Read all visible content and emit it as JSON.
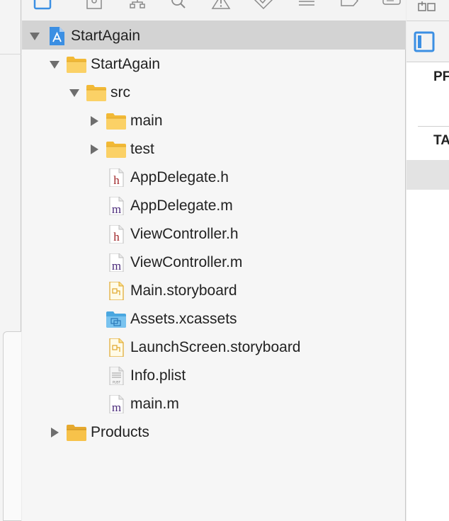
{
  "colors": {
    "accent_blue": "#3b8fe3",
    "folder_yellow": "#f7c24a",
    "header_red": "#a0272a",
    "impl_purple": "#4a2a7a",
    "selection_gray": "#d3d3d3"
  },
  "navigator": {
    "toolbar_icons": [
      "project-navigator-icon",
      "symbol-navigator-icon",
      "hierarchy-icon",
      "find-icon",
      "issue-warning-icon",
      "test-diamond-icon",
      "debug-list-icon",
      "breakpoint-tag-icon",
      "report-bubble-icon"
    ],
    "tree": [
      {
        "label": "StartAgain",
        "level": 0,
        "disclosure": "expanded",
        "icon": "project-icon",
        "selected": true
      },
      {
        "label": "StartAgain",
        "level": 1,
        "disclosure": "expanded",
        "icon": "folder-icon",
        "selected": false
      },
      {
        "label": "src",
        "level": 2,
        "disclosure": "expanded",
        "icon": "folder-icon",
        "selected": false
      },
      {
        "label": "main",
        "level": 3,
        "disclosure": "collapsed",
        "icon": "folder-icon",
        "selected": false
      },
      {
        "label": "test",
        "level": 3,
        "disclosure": "collapsed",
        "icon": "folder-icon",
        "selected": false
      },
      {
        "label": "AppDelegate.h",
        "level": 3,
        "disclosure": "none",
        "icon": "header-file-icon",
        "selected": false
      },
      {
        "label": "AppDelegate.m",
        "level": 3,
        "disclosure": "none",
        "icon": "implementation-file-icon",
        "selected": false
      },
      {
        "label": "ViewController.h",
        "level": 3,
        "disclosure": "none",
        "icon": "header-file-icon",
        "selected": false
      },
      {
        "label": "ViewController.m",
        "level": 3,
        "disclosure": "none",
        "icon": "implementation-file-icon",
        "selected": false
      },
      {
        "label": "Main.storyboard",
        "level": 3,
        "disclosure": "none",
        "icon": "storyboard-file-icon",
        "selected": false
      },
      {
        "label": "Assets.xcassets",
        "level": 3,
        "disclosure": "none",
        "icon": "asset-catalog-icon",
        "selected": false
      },
      {
        "label": "LaunchScreen.storyboard",
        "level": 3,
        "disclosure": "none",
        "icon": "storyboard-file-icon",
        "selected": false
      },
      {
        "label": "Info.plist",
        "level": 3,
        "disclosure": "none",
        "icon": "plist-file-icon",
        "selected": false
      },
      {
        "label": "main.m",
        "level": 3,
        "disclosure": "none",
        "icon": "implementation-file-icon",
        "selected": false
      },
      {
        "label": "Products",
        "level": 1,
        "disclosure": "collapsed",
        "icon": "products-folder-icon",
        "selected": false
      }
    ]
  },
  "inspector": {
    "section_1": "PF",
    "section_2": "TA"
  }
}
